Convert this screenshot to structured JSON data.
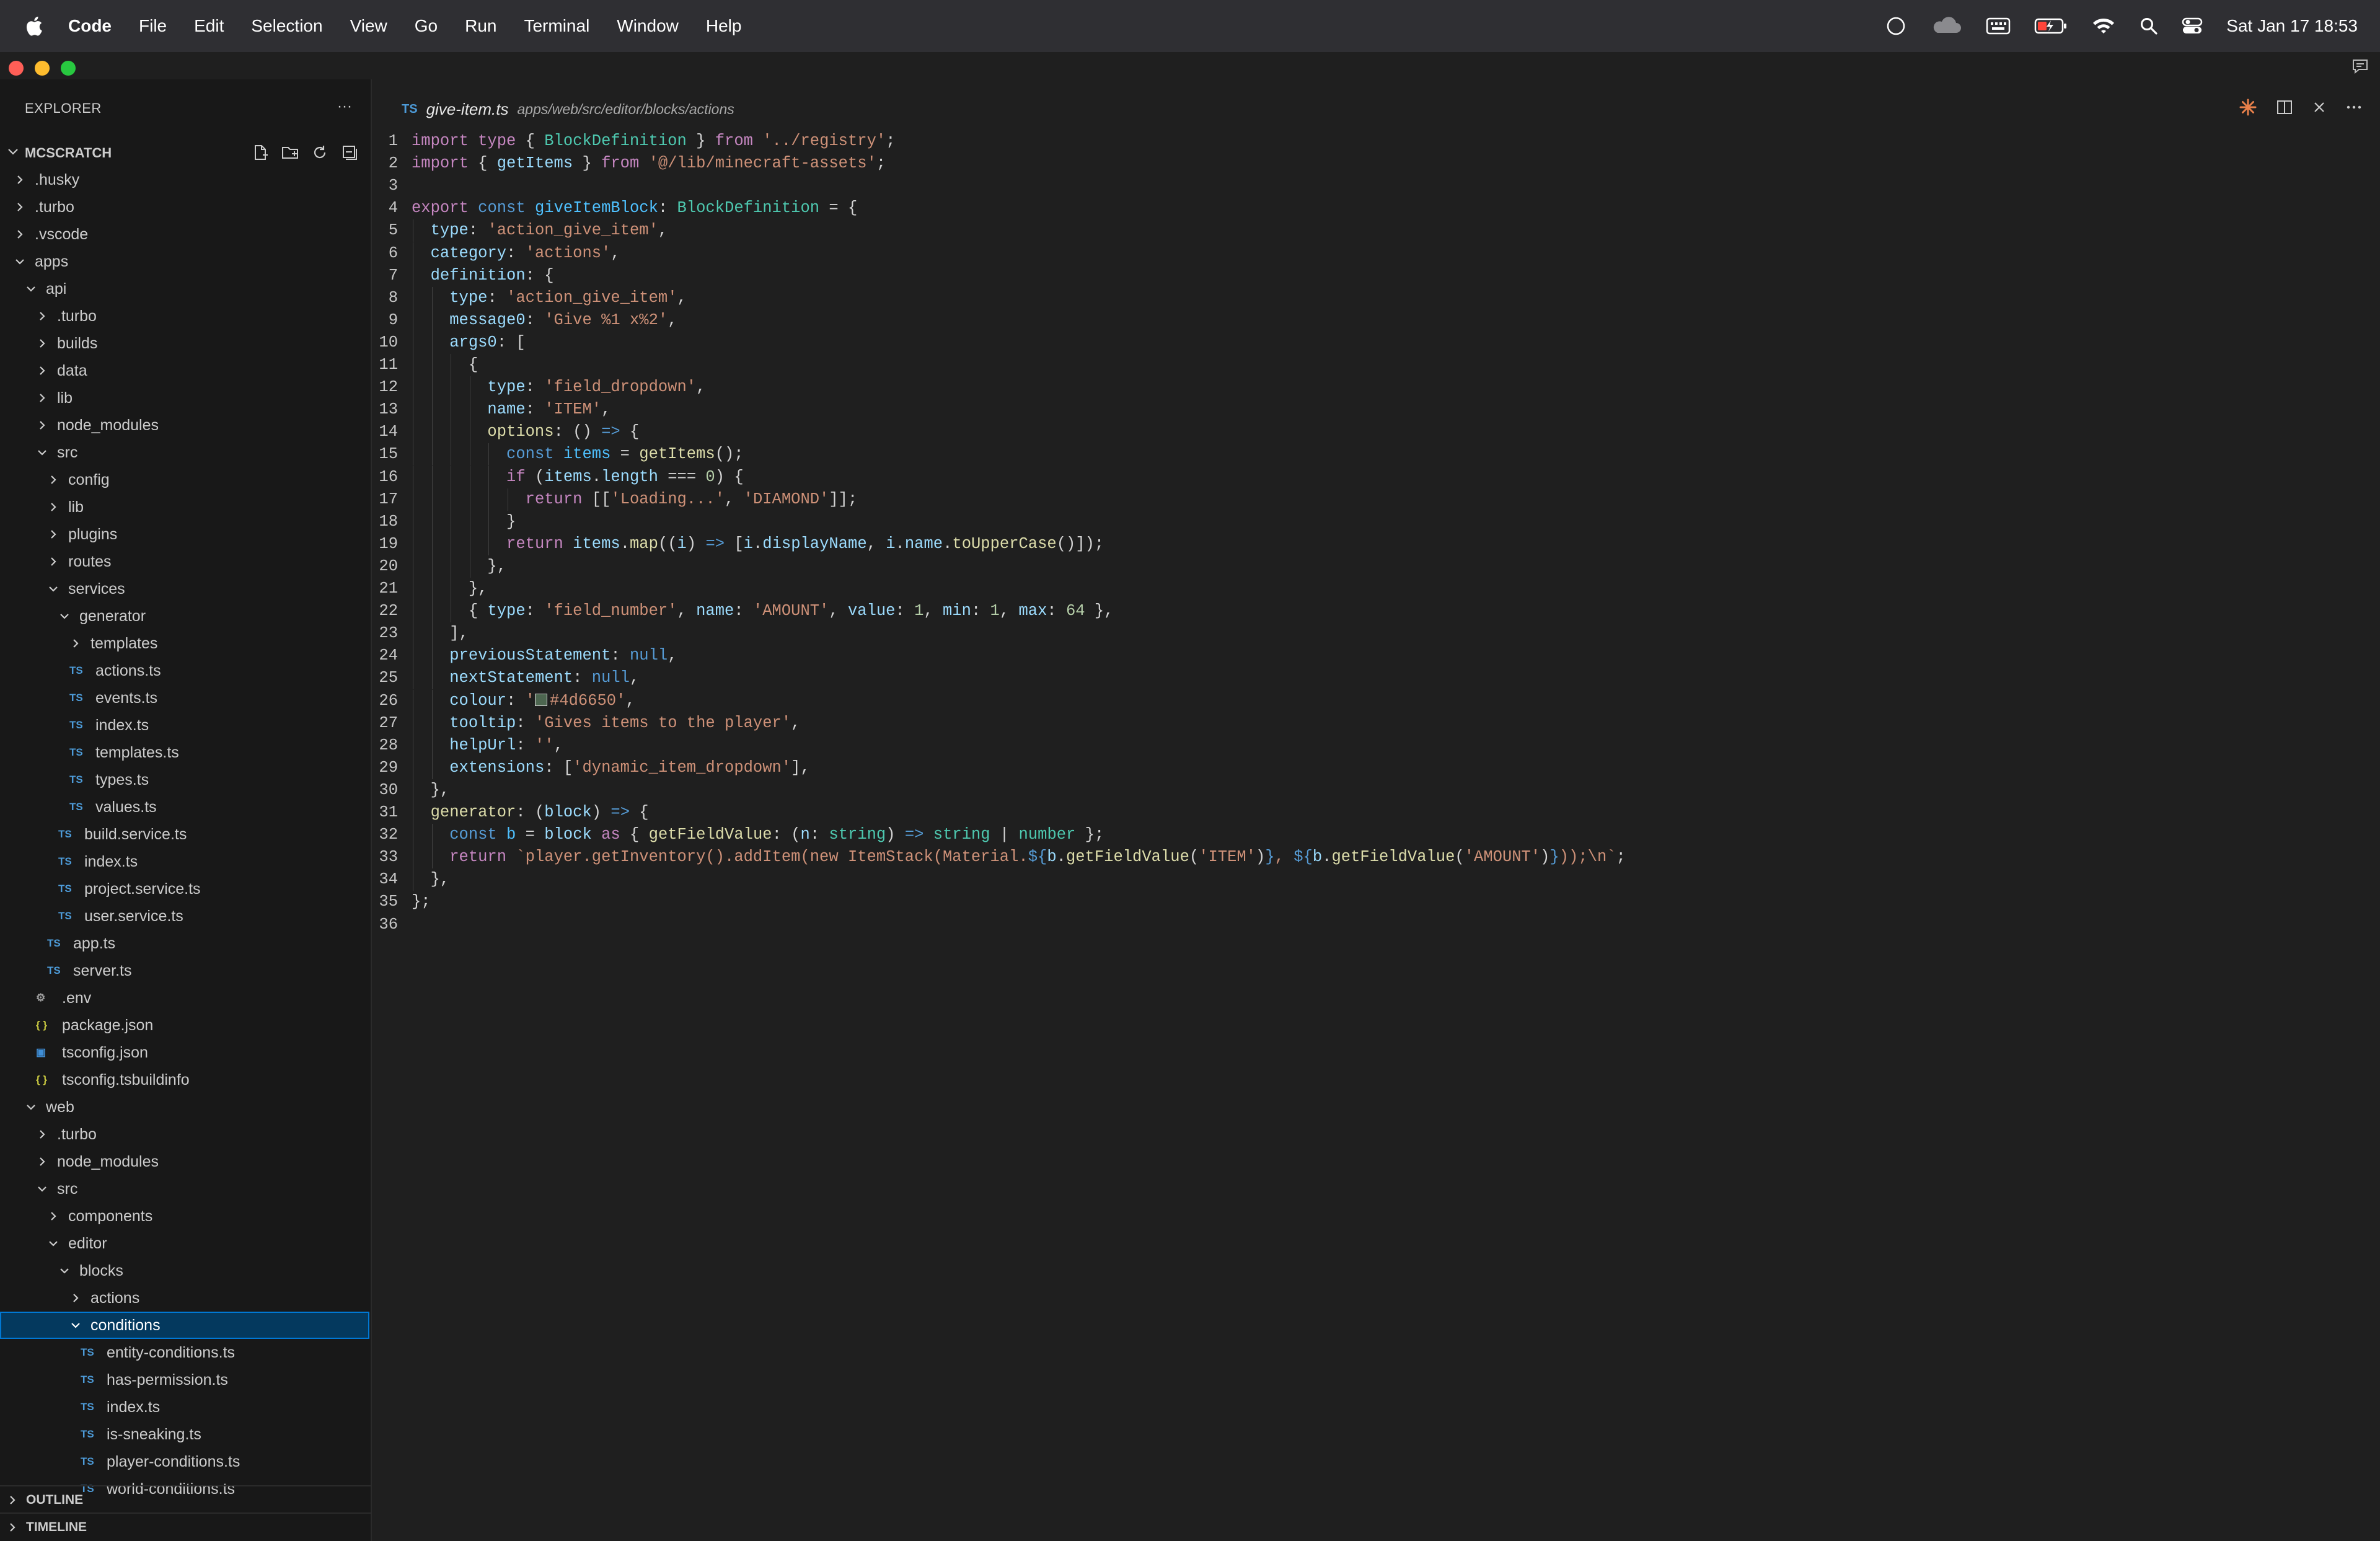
{
  "menubar": {
    "app_name": "Code",
    "menus": [
      "File",
      "Edit",
      "Selection",
      "View",
      "Go",
      "Run",
      "Terminal",
      "Window",
      "Help"
    ],
    "status_icons": [
      "circle-icon",
      "cloud-icon",
      "keyboard-icon",
      "battery-charging-icon",
      "wifi-icon",
      "spotlight-search-icon",
      "control-center-icon"
    ],
    "clock": "Sat Jan 17  18:53"
  },
  "sidebar": {
    "title": "EXPLORER",
    "more": "···",
    "workspace": "MCSCRATCH",
    "tree": [
      {
        "label": ".husky",
        "depth": 0,
        "kind": "folder",
        "open": false
      },
      {
        "label": ".turbo",
        "depth": 0,
        "kind": "folder",
        "open": false
      },
      {
        "label": ".vscode",
        "depth": 0,
        "kind": "folder",
        "open": false
      },
      {
        "label": "apps",
        "depth": 0,
        "kind": "folder",
        "open": true
      },
      {
        "label": "api",
        "depth": 1,
        "kind": "folder",
        "open": true
      },
      {
        "label": ".turbo",
        "depth": 2,
        "kind": "folder",
        "open": false
      },
      {
        "label": "builds",
        "depth": 2,
        "kind": "folder",
        "open": false
      },
      {
        "label": "data",
        "depth": 2,
        "kind": "folder",
        "open": false
      },
      {
        "label": "lib",
        "depth": 2,
        "kind": "folder",
        "open": false
      },
      {
        "label": "node_modules",
        "depth": 2,
        "kind": "folder",
        "open": false
      },
      {
        "label": "src",
        "depth": 2,
        "kind": "folder",
        "open": true
      },
      {
        "label": "config",
        "depth": 3,
        "kind": "folder",
        "open": false
      },
      {
        "label": "lib",
        "depth": 3,
        "kind": "folder",
        "open": false
      },
      {
        "label": "plugins",
        "depth": 3,
        "kind": "folder",
        "open": false
      },
      {
        "label": "routes",
        "depth": 3,
        "kind": "folder",
        "open": false
      },
      {
        "label": "services",
        "depth": 3,
        "kind": "folder",
        "open": true
      },
      {
        "label": "generator",
        "depth": 4,
        "kind": "folder",
        "open": true
      },
      {
        "label": "templates",
        "depth": 5,
        "kind": "folder",
        "open": false
      },
      {
        "label": "actions.ts",
        "depth": 5,
        "kind": "ts"
      },
      {
        "label": "events.ts",
        "depth": 5,
        "kind": "ts"
      },
      {
        "label": "index.ts",
        "depth": 5,
        "kind": "ts"
      },
      {
        "label": "templates.ts",
        "depth": 5,
        "kind": "ts"
      },
      {
        "label": "types.ts",
        "depth": 5,
        "kind": "ts"
      },
      {
        "label": "values.ts",
        "depth": 5,
        "kind": "ts"
      },
      {
        "label": "build.service.ts",
        "depth": 4,
        "kind": "ts"
      },
      {
        "label": "index.ts",
        "depth": 4,
        "kind": "ts"
      },
      {
        "label": "project.service.ts",
        "depth": 4,
        "kind": "ts"
      },
      {
        "label": "user.service.ts",
        "depth": 4,
        "kind": "ts"
      },
      {
        "label": "app.ts",
        "depth": 3,
        "kind": "ts"
      },
      {
        "label": "server.ts",
        "depth": 3,
        "kind": "ts"
      },
      {
        "label": ".env",
        "depth": 2,
        "kind": "env"
      },
      {
        "label": "package.json",
        "depth": 2,
        "kind": "json"
      },
      {
        "label": "tsconfig.json",
        "depth": 2,
        "kind": "tsconfig"
      },
      {
        "label": "tsconfig.tsbuildinfo",
        "depth": 2,
        "kind": "json"
      },
      {
        "label": "web",
        "depth": 1,
        "kind": "folder",
        "open": true
      },
      {
        "label": ".turbo",
        "depth": 2,
        "kind": "folder",
        "open": false
      },
      {
        "label": "node_modules",
        "depth": 2,
        "kind": "folder",
        "open": false
      },
      {
        "label": "src",
        "depth": 2,
        "kind": "folder",
        "open": true
      },
      {
        "label": "components",
        "depth": 3,
        "kind": "folder",
        "open": false
      },
      {
        "label": "editor",
        "depth": 3,
        "kind": "folder",
        "open": true
      },
      {
        "label": "blocks",
        "depth": 4,
        "kind": "folder",
        "open": true
      },
      {
        "label": "actions",
        "depth": 5,
        "kind": "folder",
        "open": false
      },
      {
        "label": "conditions",
        "depth": 5,
        "kind": "folder",
        "open": true,
        "selected": true
      },
      {
        "label": "entity-conditions.ts",
        "depth": 6,
        "kind": "ts"
      },
      {
        "label": "has-permission.ts",
        "depth": 6,
        "kind": "ts"
      },
      {
        "label": "index.ts",
        "depth": 6,
        "kind": "ts"
      },
      {
        "label": "is-sneaking.ts",
        "depth": 6,
        "kind": "ts"
      },
      {
        "label": "player-conditions.ts",
        "depth": 6,
        "kind": "ts"
      },
      {
        "label": "world-conditions.ts",
        "depth": 6,
        "kind": "ts"
      }
    ],
    "sections": [
      "OUTLINE",
      "TIMELINE"
    ]
  },
  "editor": {
    "tab_icon": "TS",
    "filename": "give-item.ts",
    "path": "apps/web/src/editor/blocks/actions",
    "lines": [
      [
        [
          "kw",
          "import"
        ],
        [
          "kw",
          "type"
        ],
        [
          "",
          "{ "
        ],
        [
          "typ",
          "BlockDefinition"
        ],
        [
          "",
          " } "
        ],
        [
          "kw",
          "from"
        ],
        [
          "",
          " "
        ],
        [
          "str",
          "'../registry'"
        ],
        [
          "",
          ";"
        ]
      ],
      [
        [
          "kw",
          "import"
        ],
        [
          "",
          ""
        ],
        [
          "",
          "{ "
        ],
        [
          "var",
          "getItems"
        ],
        [
          "",
          " } "
        ],
        [
          "kw",
          "from"
        ],
        [
          "",
          " "
        ],
        [
          "str",
          "'@/lib/minecraft-assets'"
        ],
        [
          "",
          ";"
        ]
      ],
      [],
      [
        [
          "kw",
          "export"
        ],
        [
          "",
          " "
        ],
        [
          "kw2",
          "const"
        ],
        [
          "",
          " "
        ],
        [
          "cst",
          "giveItemBlock"
        ],
        [
          "",
          ": "
        ],
        [
          "typ",
          "BlockDefinition"
        ],
        [
          "",
          " = {"
        ]
      ],
      [
        [
          "",
          "  "
        ],
        [
          "var",
          "type"
        ],
        [
          "",
          ": "
        ],
        [
          "str",
          "'action_give_item'"
        ],
        [
          "",
          ","
        ]
      ],
      [
        [
          "",
          "  "
        ],
        [
          "var",
          "category"
        ],
        [
          "",
          ": "
        ],
        [
          "str",
          "'actions'"
        ],
        [
          "",
          ","
        ]
      ],
      [
        [
          "",
          "  "
        ],
        [
          "var",
          "definition"
        ],
        [
          "",
          ": {"
        ]
      ],
      [
        [
          "",
          "    "
        ],
        [
          "var",
          "type"
        ],
        [
          "",
          ": "
        ],
        [
          "str",
          "'action_give_item'"
        ],
        [
          "",
          ","
        ]
      ],
      [
        [
          "",
          "    "
        ],
        [
          "var",
          "message0"
        ],
        [
          "",
          ": "
        ],
        [
          "str",
          "'Give %1 x%2'"
        ],
        [
          "",
          ","
        ]
      ],
      [
        [
          "",
          "    "
        ],
        [
          "var",
          "args0"
        ],
        [
          "",
          ": ["
        ]
      ],
      [
        [
          "",
          "      {"
        ]
      ],
      [
        [
          "",
          "        "
        ],
        [
          "var",
          "type"
        ],
        [
          "",
          ": "
        ],
        [
          "str",
          "'field_dropdown'"
        ],
        [
          "",
          ","
        ]
      ],
      [
        [
          "",
          "        "
        ],
        [
          "var",
          "name"
        ],
        [
          "",
          ": "
        ],
        [
          "str",
          "'ITEM'"
        ],
        [
          "",
          ","
        ]
      ],
      [
        [
          "",
          "        "
        ],
        [
          "fn",
          "options"
        ],
        [
          "",
          ": () "
        ],
        [
          "kw2",
          "=>"
        ],
        [
          "",
          " {"
        ]
      ],
      [
        [
          "",
          "          "
        ],
        [
          "kw2",
          "const"
        ],
        [
          "",
          " "
        ],
        [
          "cst",
          "items"
        ],
        [
          "",
          " = "
        ],
        [
          "fn",
          "getItems"
        ],
        [
          "",
          "();"
        ]
      ],
      [
        [
          "",
          "          "
        ],
        [
          "kw",
          "if"
        ],
        [
          "",
          " ("
        ],
        [
          "var",
          "items"
        ],
        [
          "",
          "."
        ],
        [
          "var",
          "length"
        ],
        [
          "",
          " === "
        ],
        [
          "num",
          "0"
        ],
        [
          "",
          ") {"
        ]
      ],
      [
        [
          "",
          "            "
        ],
        [
          "kw",
          "return"
        ],
        [
          "",
          " [["
        ],
        [
          "str",
          "'Loading...'"
        ],
        [
          "",
          ", "
        ],
        [
          "str",
          "'DIAMOND'"
        ],
        [
          "",
          "]];"
        ]
      ],
      [
        [
          "",
          "          }"
        ]
      ],
      [
        [
          "",
          "          "
        ],
        [
          "kw",
          "return"
        ],
        [
          "",
          " "
        ],
        [
          "var",
          "items"
        ],
        [
          "",
          "."
        ],
        [
          "fn",
          "map"
        ],
        [
          "",
          "(("
        ],
        [
          "var",
          "i"
        ],
        [
          "",
          ") "
        ],
        [
          "kw2",
          "=>"
        ],
        [
          "",
          " ["
        ],
        [
          "var",
          "i"
        ],
        [
          "",
          "."
        ],
        [
          "var",
          "displayName"
        ],
        [
          "",
          ", "
        ],
        [
          "var",
          "i"
        ],
        [
          "",
          "."
        ],
        [
          "var",
          "name"
        ],
        [
          "",
          "."
        ],
        [
          "fn",
          "toUpperCase"
        ],
        [
          "",
          "()]);"
        ]
      ],
      [
        [
          "",
          "        },"
        ]
      ],
      [
        [
          "",
          "      },"
        ]
      ],
      [
        [
          "",
          "      { "
        ],
        [
          "var",
          "type"
        ],
        [
          "",
          ": "
        ],
        [
          "str",
          "'field_number'"
        ],
        [
          "",
          ", "
        ],
        [
          "var",
          "name"
        ],
        [
          "",
          ": "
        ],
        [
          "str",
          "'AMOUNT'"
        ],
        [
          "",
          ", "
        ],
        [
          "var",
          "value"
        ],
        [
          "",
          ": "
        ],
        [
          "num",
          "1"
        ],
        [
          "",
          ", "
        ],
        [
          "var",
          "min"
        ],
        [
          "",
          ": "
        ],
        [
          "num",
          "1"
        ],
        [
          "",
          ", "
        ],
        [
          "var",
          "max"
        ],
        [
          "",
          ": "
        ],
        [
          "num",
          "64"
        ],
        [
          "",
          " },"
        ]
      ],
      [
        [
          "",
          "    ],"
        ]
      ],
      [
        [
          "",
          "    "
        ],
        [
          "var",
          "previousStatement"
        ],
        [
          "",
          ": "
        ],
        [
          "kw2",
          "null"
        ],
        [
          "",
          ","
        ]
      ],
      [
        [
          "",
          "    "
        ],
        [
          "var",
          "nextStatement"
        ],
        [
          "",
          ": "
        ],
        [
          "kw2",
          "null"
        ],
        [
          "",
          ","
        ]
      ],
      [
        [
          "",
          "    "
        ],
        [
          "var",
          "colour"
        ],
        [
          "",
          ": "
        ],
        [
          "str",
          "'"
        ],
        [
          "swatch",
          ""
        ],
        [
          "str",
          "#4d6650'"
        ],
        [
          "",
          ","
        ]
      ],
      [
        [
          "",
          "    "
        ],
        [
          "var",
          "tooltip"
        ],
        [
          "",
          ": "
        ],
        [
          "str",
          "'Gives items to the player'"
        ],
        [
          "",
          ","
        ]
      ],
      [
        [
          "",
          "    "
        ],
        [
          "var",
          "helpUrl"
        ],
        [
          "",
          ": "
        ],
        [
          "str",
          "''"
        ],
        [
          "",
          ","
        ]
      ],
      [
        [
          "",
          "    "
        ],
        [
          "var",
          "extensions"
        ],
        [
          "",
          ": ["
        ],
        [
          "str",
          "'dynamic_item_dropdown'"
        ],
        [
          "",
          "],"
        ]
      ],
      [
        [
          "",
          "  },"
        ]
      ],
      [
        [
          "",
          "  "
        ],
        [
          "fn",
          "generator"
        ],
        [
          "",
          ": ("
        ],
        [
          "var",
          "block"
        ],
        [
          "",
          ") "
        ],
        [
          "kw2",
          "=>"
        ],
        [
          "",
          " {"
        ]
      ],
      [
        [
          "",
          "    "
        ],
        [
          "kw2",
          "const"
        ],
        [
          "",
          " "
        ],
        [
          "cst",
          "b"
        ],
        [
          "",
          " = "
        ],
        [
          "var",
          "block"
        ],
        [
          "",
          " "
        ],
        [
          "kw",
          "as"
        ],
        [
          "",
          " { "
        ],
        [
          "fn",
          "getFieldValue"
        ],
        [
          "",
          ": ("
        ],
        [
          "var",
          "n"
        ],
        [
          "",
          ": "
        ],
        [
          "typ",
          "string"
        ],
        [
          "",
          ") "
        ],
        [
          "kw2",
          "=>"
        ],
        [
          "",
          " "
        ],
        [
          "typ",
          "string"
        ],
        [
          "",
          " | "
        ],
        [
          "typ",
          "number"
        ],
        [
          "",
          " };"
        ]
      ],
      [
        [
          "",
          "    "
        ],
        [
          "kw",
          "return"
        ],
        [
          "",
          " "
        ],
        [
          "str",
          "`player.getInventory().addItem(new ItemStack(Material."
        ],
        [
          "kw2",
          "${"
        ],
        [
          "var",
          "b"
        ],
        [
          "",
          "."
        ],
        [
          "fn",
          "getFieldValue"
        ],
        [
          "",
          "("
        ],
        [
          "str",
          "'ITEM'"
        ],
        [
          "",
          ")"
        ],
        [
          "kw2",
          "}"
        ],
        [
          "str",
          ", "
        ],
        [
          "kw2",
          "${"
        ],
        [
          "var",
          "b"
        ],
        [
          "",
          "."
        ],
        [
          "fn",
          "getFieldValue"
        ],
        [
          "",
          "("
        ],
        [
          "str",
          "'AMOUNT'"
        ],
        [
          "",
          ")"
        ],
        [
          "kw2",
          "}"
        ],
        [
          "str",
          "));\\n`"
        ],
        [
          "",
          ";"
        ]
      ],
      [
        [
          "",
          "  },"
        ]
      ],
      [
        [
          "",
          "};"
        ]
      ],
      []
    ]
  }
}
